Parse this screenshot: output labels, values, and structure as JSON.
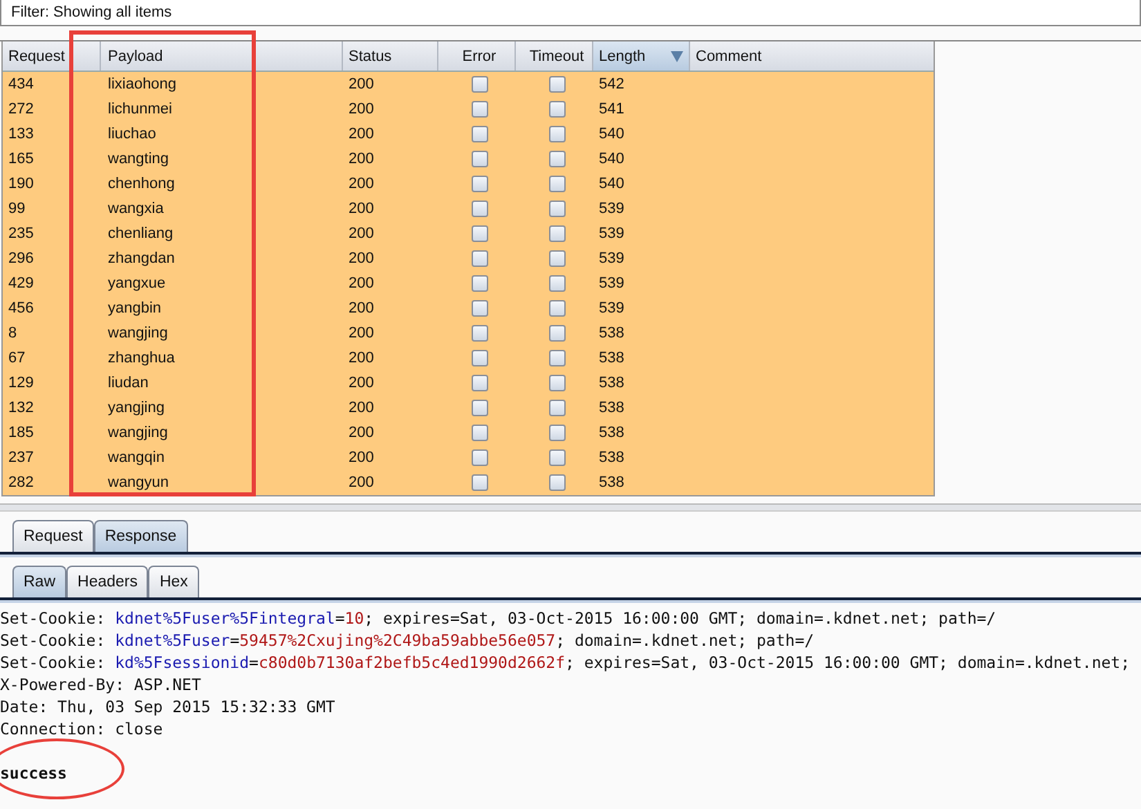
{
  "filter": {
    "text": "Filter:  Showing all items"
  },
  "table": {
    "columns": [
      {
        "label": "Request"
      },
      {
        "label": "Payload",
        "highlighted": true
      },
      {
        "label": "Status"
      },
      {
        "label": "Error"
      },
      {
        "label": "Timeout"
      },
      {
        "label": "Length",
        "sorted_descending": true
      },
      {
        "label": "Comment"
      }
    ],
    "rows": [
      {
        "request": "434",
        "payload": "lixiaohong",
        "status": "200",
        "error": false,
        "timeout": false,
        "length": "542"
      },
      {
        "request": "272",
        "payload": "lichunmei",
        "status": "200",
        "error": false,
        "timeout": false,
        "length": "541"
      },
      {
        "request": "133",
        "payload": "liuchao",
        "status": "200",
        "error": false,
        "timeout": false,
        "length": "540"
      },
      {
        "request": "165",
        "payload": "wangting",
        "status": "200",
        "error": false,
        "timeout": false,
        "length": "540"
      },
      {
        "request": "190",
        "payload": "chenhong",
        "status": "200",
        "error": false,
        "timeout": false,
        "length": "540"
      },
      {
        "request": "99",
        "payload": "wangxia",
        "status": "200",
        "error": false,
        "timeout": false,
        "length": "539"
      },
      {
        "request": "235",
        "payload": "chenliang",
        "status": "200",
        "error": false,
        "timeout": false,
        "length": "539"
      },
      {
        "request": "296",
        "payload": "zhangdan",
        "status": "200",
        "error": false,
        "timeout": false,
        "length": "539"
      },
      {
        "request": "429",
        "payload": "yangxue",
        "status": "200",
        "error": false,
        "timeout": false,
        "length": "539"
      },
      {
        "request": "456",
        "payload": "yangbin",
        "status": "200",
        "error": false,
        "timeout": false,
        "length": "539"
      },
      {
        "request": "8",
        "payload": "wangjing",
        "status": "200",
        "error": false,
        "timeout": false,
        "length": "538"
      },
      {
        "request": "67",
        "payload": "zhanghua",
        "status": "200",
        "error": false,
        "timeout": false,
        "length": "538"
      },
      {
        "request": "129",
        "payload": "liudan",
        "status": "200",
        "error": false,
        "timeout": false,
        "length": "538"
      },
      {
        "request": "132",
        "payload": "yangjing",
        "status": "200",
        "error": false,
        "timeout": false,
        "length": "538"
      },
      {
        "request": "185",
        "payload": "wangjing",
        "status": "200",
        "error": false,
        "timeout": false,
        "length": "538"
      },
      {
        "request": "237",
        "payload": "wangqin",
        "status": "200",
        "error": false,
        "timeout": false,
        "length": "538"
      },
      {
        "request": "282",
        "payload": "wangyun",
        "status": "200",
        "error": false,
        "timeout": false,
        "length": "538"
      }
    ]
  },
  "message_tabs": [
    {
      "label": "Request",
      "selected": false
    },
    {
      "label": "Response",
      "selected": true
    }
  ],
  "view_tabs": [
    {
      "label": "Raw",
      "selected": true
    },
    {
      "label": "Headers",
      "selected": false
    },
    {
      "label": "Hex",
      "selected": false
    }
  ],
  "response_lines": [
    [
      {
        "kind": "plain",
        "text": "Set-Cookie: "
      },
      {
        "kind": "name",
        "text": "kdnet%5Fuser%5Fintegral"
      },
      {
        "kind": "plain",
        "text": "="
      },
      {
        "kind": "value",
        "text": "10"
      },
      {
        "kind": "plain",
        "text": "; expires=Sat, 03-Oct-2015 16:00:00 GMT; domain=.kdnet.net; path=/"
      }
    ],
    [
      {
        "kind": "plain",
        "text": "Set-Cookie: "
      },
      {
        "kind": "name",
        "text": "kdnet%5Fuser"
      },
      {
        "kind": "plain",
        "text": "="
      },
      {
        "kind": "value",
        "text": "59457%2Cxujing%2C49ba59abbe56e057"
      },
      {
        "kind": "plain",
        "text": "; domain=.kdnet.net; path=/"
      }
    ],
    [
      {
        "kind": "plain",
        "text": "Set-Cookie: "
      },
      {
        "kind": "name",
        "text": "kd%5Fsessionid"
      },
      {
        "kind": "plain",
        "text": "="
      },
      {
        "kind": "value",
        "text": "c80d0b7130af2befb5c4ed1990d2662f"
      },
      {
        "kind": "plain",
        "text": "; expires=Sat, 03-Oct-2015 16:00:00 GMT; domain=.kdnet.net;"
      }
    ],
    [
      {
        "kind": "plain",
        "text": "X-Powered-By: ASP.NET"
      }
    ],
    [
      {
        "kind": "plain",
        "text": "Date: Thu, 03 Sep 2015 15:32:33 GMT"
      }
    ],
    [
      {
        "kind": "plain",
        "text": "Connection: close"
      }
    ]
  ],
  "response_body": {
    "text": "success",
    "highlighted": true
  }
}
